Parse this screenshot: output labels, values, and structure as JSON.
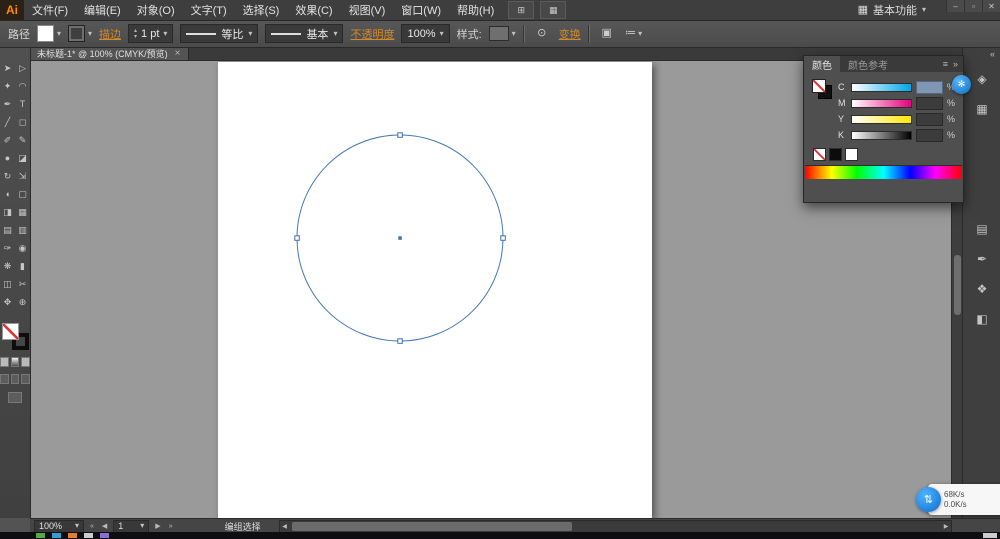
{
  "colors": {
    "link_accent": "#d2892a",
    "selection_blue": "#4377b5",
    "canvas_gray": "#9a9a9a"
  },
  "menubar": {
    "logo": "Ai",
    "menus": [
      "文件(F)",
      "编辑(E)",
      "对象(O)",
      "文字(T)",
      "选择(S)",
      "效果(C)",
      "视图(V)",
      "窗口(W)",
      "帮助(H)"
    ],
    "doc_icons": [
      {
        "name": "arrange-documents-icon",
        "glyph": "⊞"
      },
      {
        "name": "document-layout-icon",
        "glyph": "▦"
      }
    ],
    "workspace_icon": "▦",
    "workspace": "基本功能",
    "caret": "▾",
    "window_controls": [
      {
        "name": "minimize-button",
        "glyph": "–"
      },
      {
        "name": "restore-button",
        "glyph": "▫"
      },
      {
        "name": "close-button",
        "glyph": "✕"
      }
    ]
  },
  "controlbar": {
    "context": "路径",
    "caret": "▾",
    "stepper_up": "▴",
    "stepper_down": "▾",
    "stroke_link": "描边",
    "stroke_width": "1 pt",
    "profile_label": "等比",
    "brush_label": "基本",
    "opacity_link": "不透明度",
    "opacity_value": "100%",
    "style_label": "样式:",
    "recolor_icon": "⊙",
    "transform_link": "变换",
    "isolate_icon": "▣",
    "similar_icon": "≔"
  },
  "tools": [
    {
      "name": "selection-tool",
      "glyph": "➤"
    },
    {
      "name": "direct-selection-tool",
      "glyph": "▷"
    },
    {
      "name": "magic-wand-tool",
      "glyph": "✦"
    },
    {
      "name": "lasso-tool",
      "glyph": "◠"
    },
    {
      "name": "pen-tool",
      "glyph": "✒"
    },
    {
      "name": "type-tool",
      "glyph": "T"
    },
    {
      "name": "line-segment-tool",
      "glyph": "╱"
    },
    {
      "name": "rectangle-tool",
      "glyph": "◻"
    },
    {
      "name": "paintbrush-tool",
      "glyph": "✐"
    },
    {
      "name": "pencil-tool",
      "glyph": "✎"
    },
    {
      "name": "blob-brush-tool",
      "glyph": "●"
    },
    {
      "name": "eraser-tool",
      "glyph": "◪"
    },
    {
      "name": "rotate-tool",
      "glyph": "↻"
    },
    {
      "name": "scale-tool",
      "glyph": "⇲"
    },
    {
      "name": "width-tool",
      "glyph": "◖"
    },
    {
      "name": "free-transform-tool",
      "glyph": "▢"
    },
    {
      "name": "shape-builder-tool",
      "glyph": "◨"
    },
    {
      "name": "perspective-grid-tool",
      "glyph": "▦"
    },
    {
      "name": "mesh-tool",
      "glyph": "▤"
    },
    {
      "name": "gradient-tool",
      "glyph": "▥"
    },
    {
      "name": "eyedropper-tool",
      "glyph": "✑"
    },
    {
      "name": "blend-tool",
      "glyph": "◉"
    },
    {
      "name": "symbol-sprayer-tool",
      "glyph": "❋"
    },
    {
      "name": "column-graph-tool",
      "glyph": "▮"
    },
    {
      "name": "artboard-tool",
      "glyph": "◫"
    },
    {
      "name": "slice-tool",
      "glyph": "✂"
    },
    {
      "name": "hand-tool",
      "glyph": "✥"
    },
    {
      "name": "zoom-tool",
      "glyph": "⊕"
    }
  ],
  "tab": {
    "title": "未标题-1* @ 100% (CMYK/预览)",
    "close": "×"
  },
  "color_panel": {
    "tab_color": "颜色",
    "tab_guide": "颜色参考",
    "collapse": "»",
    "menu": "≡",
    "percent": "%",
    "channels": [
      {
        "label": "C",
        "value": "",
        "grad": "linear-gradient(to right,#ffffff,#00a6e8)",
        "selected": true
      },
      {
        "label": "M",
        "value": "",
        "grad": "linear-gradient(to right,#ffffff,#e6007e)"
      },
      {
        "label": "Y",
        "value": "",
        "grad": "linear-gradient(to right,#ffffff,#ffe800)"
      },
      {
        "label": "K",
        "value": "",
        "grad": "linear-gradient(to right,#ffffff,#000000)"
      }
    ]
  },
  "dock": {
    "expand": "«",
    "icons": [
      {
        "name": "color-themes-panel-icon",
        "glyph": "◈"
      },
      {
        "name": "adjustments-panel-icon",
        "glyph": "▦"
      },
      {
        "name": "swatches-panel-icon",
        "glyph": "▤",
        "gap": true
      },
      {
        "name": "brushes-panel-icon",
        "glyph": "✒"
      },
      {
        "name": "symbols-panel-icon",
        "glyph": "❖"
      },
      {
        "name": "graphic-styles-panel-icon",
        "glyph": "◧"
      }
    ]
  },
  "statusbar": {
    "zoom": "100%",
    "caret": "▾",
    "nav_first": "«",
    "nav_prev": "◀",
    "artboard": "1",
    "nav_next": "▶",
    "nav_last": "»",
    "status": "编组选择",
    "scroll_left": "◀",
    "scroll_right": "▶"
  },
  "net_overlay": {
    "icon": "⇅",
    "up": "68K/s",
    "down": "0.0K/s"
  },
  "overlay_ball": {
    "glyph": "✻"
  },
  "taskbar": {
    "icons": [
      {
        "name": "taskbar-app-icon",
        "color": "#55a948"
      },
      {
        "name": "taskbar-app-icon",
        "color": "#2f9fd6"
      },
      {
        "name": "taskbar-app-icon",
        "color": "#e07f2c"
      },
      {
        "name": "taskbar-app-icon",
        "color": "#c9cdd2"
      },
      {
        "name": "taskbar-app-icon",
        "color": "#8a6fd1"
      }
    ]
  }
}
